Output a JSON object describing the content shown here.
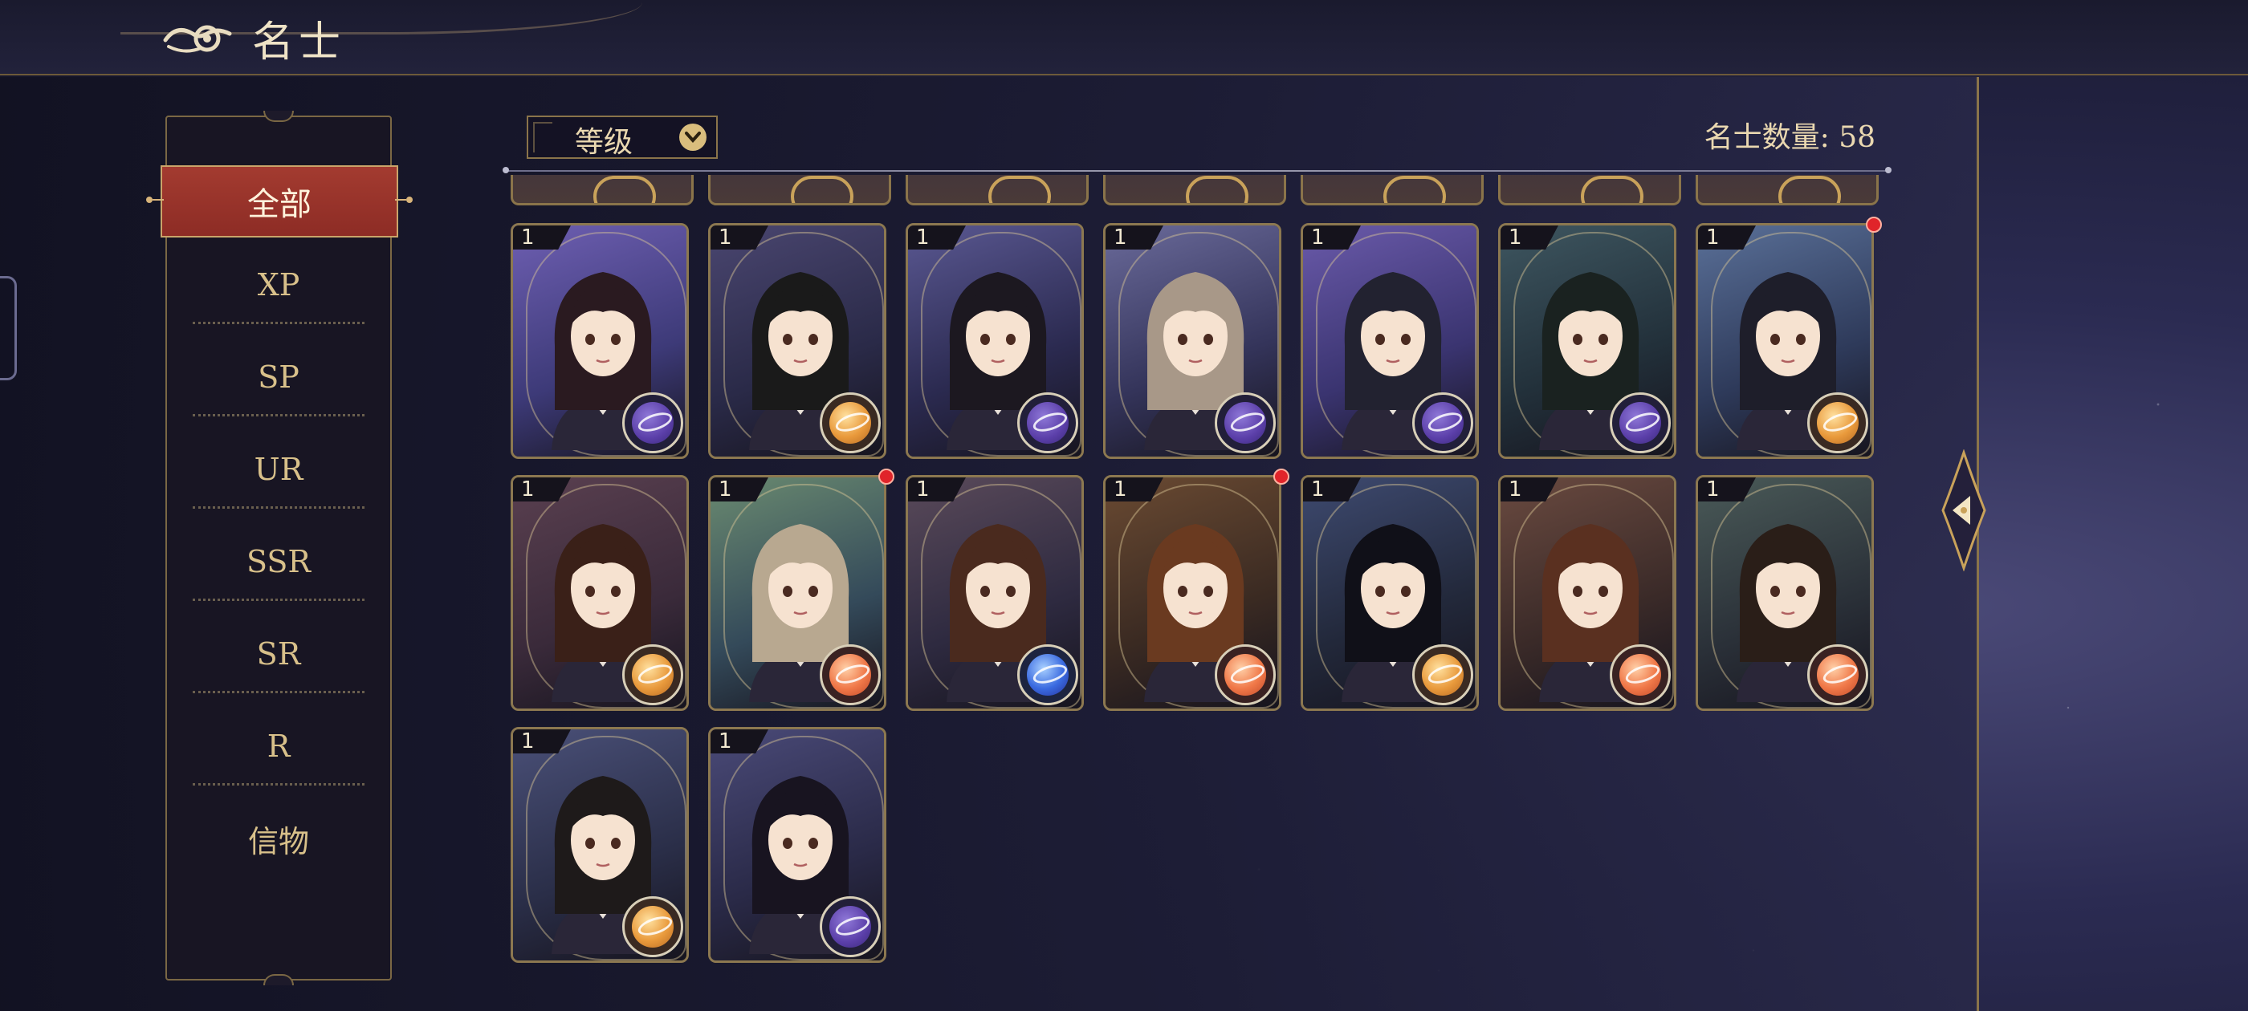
{
  "header": {
    "title": "名士",
    "back_icon": "cloud-swirl-back-icon"
  },
  "sidebar": {
    "items": [
      {
        "label": "全部",
        "active": true
      },
      {
        "label": "XP",
        "active": false
      },
      {
        "label": "SP",
        "active": false
      },
      {
        "label": "UR",
        "active": false
      },
      {
        "label": "SSR",
        "active": false
      },
      {
        "label": "SR",
        "active": false
      },
      {
        "label": "R",
        "active": false
      },
      {
        "label": "信物",
        "active": false
      }
    ]
  },
  "toolbar": {
    "sort_label": "等级",
    "count_label": "名士数量:",
    "count_value": "58"
  },
  "cards": [
    {
      "level": "1",
      "badge": "purple",
      "notify": false
    },
    {
      "level": "1",
      "badge": "gold",
      "notify": false
    },
    {
      "level": "1",
      "badge": "purple",
      "notify": false
    },
    {
      "level": "1",
      "badge": "purple",
      "notify": false
    },
    {
      "level": "1",
      "badge": "purple",
      "notify": false
    },
    {
      "level": "1",
      "badge": "purple",
      "notify": false
    },
    {
      "level": "1",
      "badge": "gold",
      "notify": true
    },
    {
      "level": "1",
      "badge": "gold",
      "notify": false
    },
    {
      "level": "1",
      "badge": "red",
      "notify": true
    },
    {
      "level": "1",
      "badge": "blue",
      "notify": false
    },
    {
      "level": "1",
      "badge": "red",
      "notify": true
    },
    {
      "level": "1",
      "badge": "gold",
      "notify": false
    },
    {
      "level": "1",
      "badge": "red",
      "notify": false
    },
    {
      "level": "1",
      "badge": "red",
      "notify": false
    },
    {
      "level": "1",
      "badge": "gold",
      "notify": false
    },
    {
      "level": "1",
      "badge": "purple",
      "notify": false
    }
  ],
  "colors": {
    "accent_gold": "#d9bd7d",
    "active_tab": "#a33b30",
    "notify_dot": "#e0242a"
  }
}
